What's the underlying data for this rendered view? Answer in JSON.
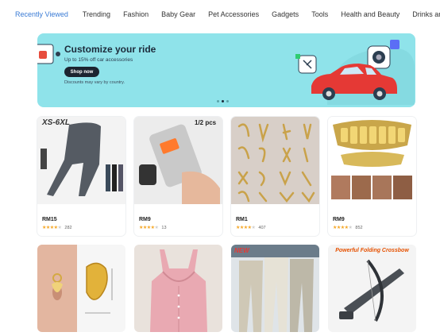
{
  "nav": {
    "categories": [
      {
        "label": "Recently Viewed",
        "active": true
      },
      {
        "label": "Trending"
      },
      {
        "label": "Fashion"
      },
      {
        "label": "Baby Gear"
      },
      {
        "label": "Pet Accessories"
      },
      {
        "label": "Gadgets"
      },
      {
        "label": "Tools"
      },
      {
        "label": "Health and Beauty"
      },
      {
        "label": "Drinks and Snacks"
      }
    ],
    "accent_color": "#3a7bd5"
  },
  "banner": {
    "title": "Customize your ride",
    "subtitle": "Up to 15% off car accessories",
    "button_label": "Shop now",
    "note": "Discounts may vary by country.",
    "background_color": "#8fe3ea",
    "slides": 3,
    "active_slide": 2
  },
  "products": [
    {
      "image_label": "XS-6XL",
      "price": "RM15",
      "stars": 4,
      "reviews": "282"
    },
    {
      "image_label": "1/2 pcs",
      "price": "RM9",
      "stars": 4,
      "reviews": "13"
    },
    {
      "image_label": "",
      "price": "RM1",
      "stars": 4,
      "reviews": "407"
    },
    {
      "image_label": "",
      "price": "RM9",
      "stars": 4,
      "reviews": "852"
    },
    {
      "image_label": ""
    },
    {
      "image_label": ""
    },
    {
      "image_label": "NEW"
    },
    {
      "image_label": "Powerful Folding Crossbow"
    }
  ]
}
